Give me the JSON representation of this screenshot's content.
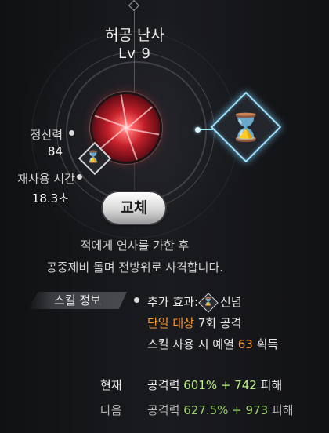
{
  "skill": {
    "name": "허공 난사",
    "level": "Lv 9"
  },
  "stats": {
    "spirit_label": "정신력",
    "spirit_value": "84",
    "cooldown_label": "재사용 시간",
    "cooldown_value": "18.3초"
  },
  "swap_button": "교체",
  "description": {
    "line1": "적에게 연사를 가한 후",
    "line2": "공중제비 돌며 전방위로 사격합니다."
  },
  "info": {
    "tab_label": "스킬 정보",
    "extra_effect_label": "추가 효과:",
    "extra_effect_name": "신념",
    "single_target": "단일 대상",
    "hit_count": "7회 공격",
    "preview_prefix": "스킬 사용 시 예열",
    "preview_value": "63",
    "preview_suffix": "획득"
  },
  "damage": {
    "current_label": "현재",
    "current_attack_label": "공격력",
    "current_percent": "601%",
    "current_plus": "+",
    "current_flat": "742",
    "current_suffix": "피해",
    "next_label": "다음",
    "next_attack_label": "공격력",
    "next_percent": "627.5%",
    "next_plus": "+",
    "next_flat": "973",
    "next_suffix": "피해"
  },
  "icons": {
    "skill_orb": "red-energy-burst-icon",
    "rune": "hourglass-icon",
    "effect": "hourglass-icon"
  },
  "colors": {
    "highlight_orange": "#ff9a2e",
    "value_green": "#b9f07c",
    "rune_glow": "#9fe3ff"
  }
}
